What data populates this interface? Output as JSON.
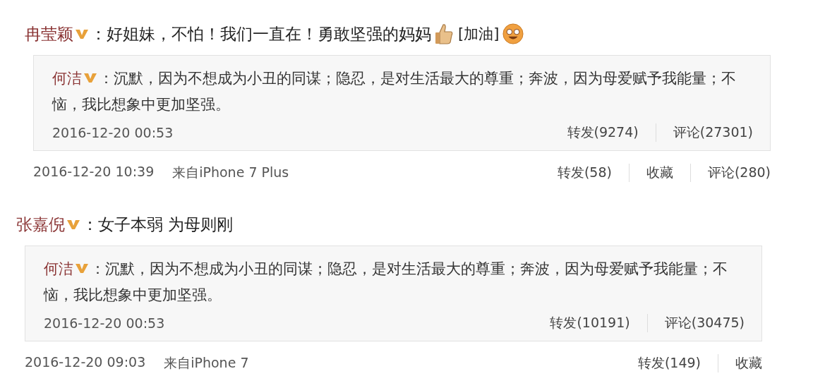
{
  "posts": [
    {
      "author": "冉莹颖",
      "verified": true,
      "separator": "：",
      "text": "好姐妹，不怕！我们一直在！勇敢坚强的妈妈",
      "extras": [
        {
          "kind": "thumb"
        },
        {
          "kind": "tag",
          "text": "[加油]"
        },
        {
          "kind": "face"
        }
      ],
      "quote": {
        "author": "何洁",
        "verified": true,
        "separator": "：",
        "text": "沉默，因为不想成为小丑的同谋；隐忍，是对生活最大的尊重；奔波，因为母爱赋予我能量；不恼，我比想象中更加坚强。",
        "time": "2016-12-20 00:53",
        "actions": [
          "转发(9274)",
          "评论(27301)"
        ]
      },
      "time": "2016-12-20 10:39",
      "source": "来自iPhone 7 Plus",
      "actions": [
        "转发(58)",
        "收藏",
        "评论(280)"
      ]
    },
    {
      "author": "张嘉倪",
      "verified": true,
      "separator": "：",
      "text": "女子本弱 为母则刚",
      "quote": {
        "author": "何洁",
        "verified": true,
        "separator": "：",
        "text": "沉默，因为不想成为小丑的同谋；隐忍，是对生活最大的尊重；奔波，因为母爱赋予我能量；不恼，我比想象中更加坚强。",
        "time": "2016-12-20 00:53",
        "actions": [
          "转发(10191)",
          "评论(30475)"
        ]
      },
      "time": "2016-12-20 09:03",
      "source": "来自iPhone 7",
      "actions": [
        "转发(149)",
        "收藏"
      ]
    }
  ]
}
